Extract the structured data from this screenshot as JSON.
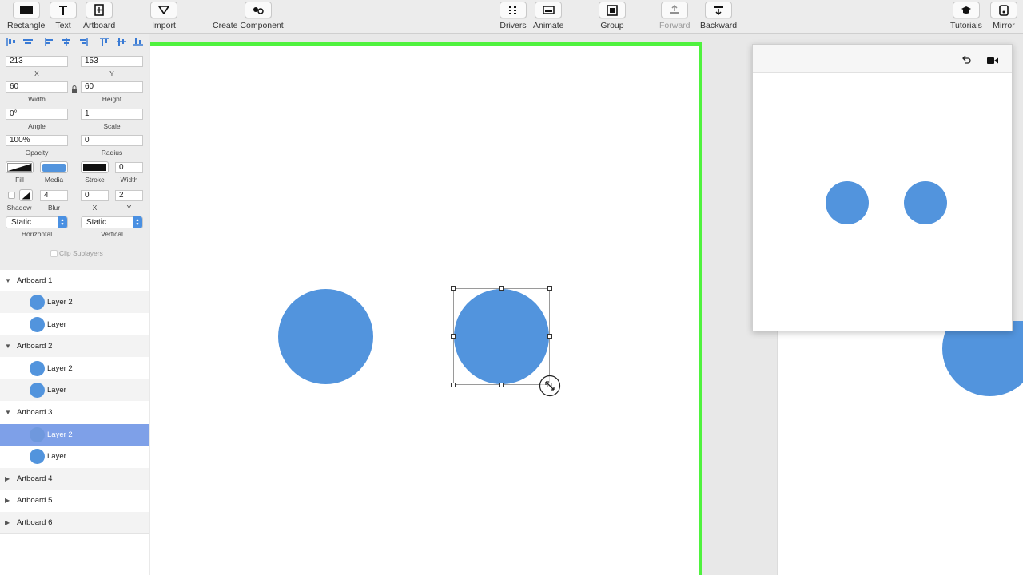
{
  "toolbar": {
    "left": [
      {
        "label": "Rectangle",
        "icon": "rectangle-icon"
      },
      {
        "label": "Text",
        "icon": "text-icon"
      },
      {
        "label": "Artboard",
        "icon": "artboard-icon"
      },
      {
        "label": "Import",
        "icon": "import-icon"
      },
      {
        "label": "Create Component",
        "icon": "component-icon"
      }
    ],
    "center": [
      {
        "label": "Drivers",
        "icon": "drivers-icon"
      },
      {
        "label": "Animate",
        "icon": "animate-icon"
      },
      {
        "label": "Group",
        "icon": "group-icon"
      },
      {
        "label": "Forward",
        "icon": "forward-icon",
        "disabled": true
      },
      {
        "label": "Backward",
        "icon": "backward-icon"
      }
    ],
    "right": [
      {
        "label": "Tutorials",
        "icon": "tutorials-icon"
      },
      {
        "label": "Mirror",
        "icon": "mirror-icon"
      }
    ]
  },
  "inspector": {
    "x": {
      "value": "213",
      "label": "X"
    },
    "y": {
      "value": "153",
      "label": "Y"
    },
    "width": {
      "value": "60",
      "label": "Width"
    },
    "height": {
      "value": "60",
      "label": "Height"
    },
    "angle": {
      "value": "0°",
      "label": "Angle"
    },
    "scale": {
      "value": "1",
      "label": "Scale"
    },
    "opacity": {
      "value": "100%",
      "label": "Opacity"
    },
    "radius": {
      "value": "0",
      "label": "Radius"
    },
    "fill_label": "Fill",
    "media_label": "Media",
    "stroke_label": "Stroke",
    "stroke_width": {
      "value": "0",
      "label": "Width"
    },
    "shadow_label": "Shadow",
    "blur": {
      "value": "4",
      "label": "Blur"
    },
    "shadow_x": {
      "value": "0",
      "label": "X"
    },
    "shadow_y": {
      "value": "2",
      "label": "Y"
    },
    "horizontal": {
      "value": "Static",
      "label": "Horizontal"
    },
    "vertical": {
      "value": "Static",
      "label": "Vertical"
    },
    "clip_sublayers": "Clip Sublayers"
  },
  "layers": [
    {
      "type": "artboard",
      "label": "Artboard 1",
      "expanded": true
    },
    {
      "type": "layer",
      "label": "Layer 2"
    },
    {
      "type": "layer",
      "label": "Layer"
    },
    {
      "type": "artboard",
      "label": "Artboard 2",
      "expanded": true
    },
    {
      "type": "layer",
      "label": "Layer 2"
    },
    {
      "type": "layer",
      "label": "Layer"
    },
    {
      "type": "artboard",
      "label": "Artboard 3",
      "expanded": true
    },
    {
      "type": "layer",
      "label": "Layer 2",
      "selected": true
    },
    {
      "type": "layer",
      "label": "Layer"
    },
    {
      "type": "artboard",
      "label": "Artboard 4",
      "expanded": false
    },
    {
      "type": "artboard",
      "label": "Artboard 5",
      "expanded": false
    },
    {
      "type": "artboard",
      "label": "Artboard 6",
      "expanded": false
    }
  ],
  "colors": {
    "accent": "#4a90e2",
    "circle": "#5294dd",
    "artboard_outline": "#4ff23e",
    "selected_row": "#7ea0e8"
  },
  "preview": {
    "icons": [
      "undo-icon",
      "record-icon"
    ]
  }
}
